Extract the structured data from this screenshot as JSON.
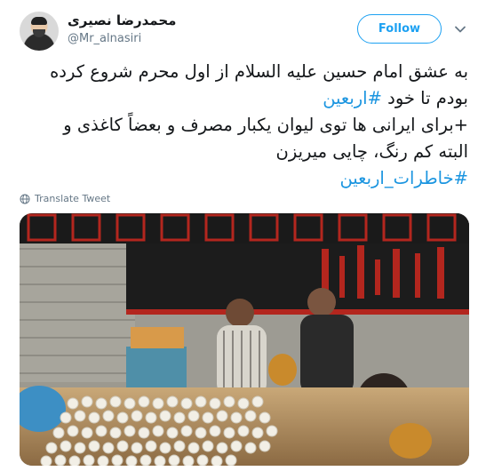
{
  "author": {
    "display_name": "محمدرضا نصیری",
    "handle": "@Mr_alnasiri",
    "avatar_icon": "profile-avatar"
  },
  "follow_label": "Follow",
  "tweet": {
    "line1": "به عشق امام حسین علیه السلام از اول محرم شروع کرده",
    "line2_text": "بودم تا خود ",
    "line2_hashtag": "#اربعین",
    "line3": "+برای ایرانی ها توی لیوان یکبار مصرف و بعضاً کاغذی و",
    "line4": "البته کم رنگ، چایی میریزن",
    "line5_hashtag": "#خاطرات_اربعین"
  },
  "translate_label": "Translate Tweet",
  "colors": {
    "accent": "#1da1f2",
    "hashtag": "#1b95e0",
    "secondary_text": "#657786"
  }
}
